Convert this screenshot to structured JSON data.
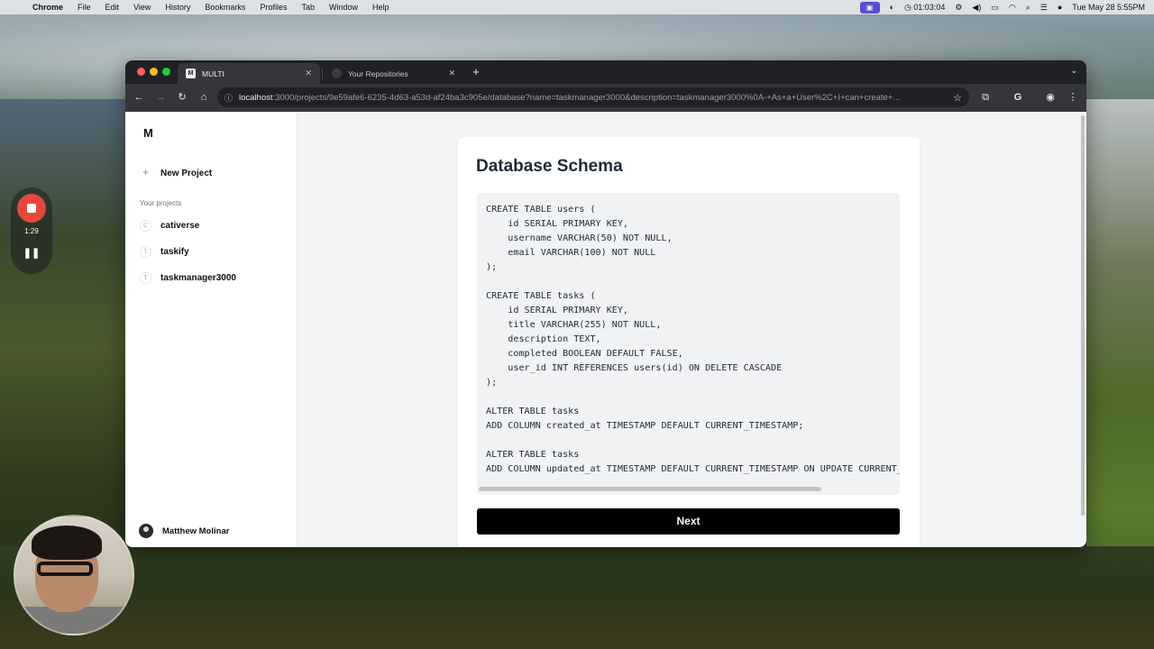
{
  "menubar": {
    "app": "Chrome",
    "items": [
      "File",
      "Edit",
      "View",
      "History",
      "Bookmarks",
      "Profiles",
      "Tab",
      "Window",
      "Help"
    ],
    "clock_timer": "01:03:04",
    "datetime": "Tue May 28  5:55PM"
  },
  "recorder": {
    "elapsed": "1:29"
  },
  "browser": {
    "tabs": [
      {
        "title": "MULTI",
        "favicon": "M",
        "active": true
      },
      {
        "title": "Your Repositories",
        "active": false
      }
    ],
    "url_host": "localhost",
    "url_rest": ":3000/projects/9e59afe6-6235-4d63-a53d-af24ba3c905e/database?name=taskmanager3000&description=taskmanager3000%0A-+As+a+User%2C+I+can+create+..."
  },
  "sidebar": {
    "logo": "M",
    "new_project": "New Project",
    "projects_label": "Your projects",
    "projects": [
      {
        "initial": "C",
        "name": "cativerse"
      },
      {
        "initial": "T",
        "name": "taskify"
      },
      {
        "initial": "T",
        "name": "taskmanager3000"
      }
    ],
    "user": "Matthew Molinar"
  },
  "main": {
    "title": "Database Schema",
    "code": "CREATE TABLE users (\n    id SERIAL PRIMARY KEY,\n    username VARCHAR(50) NOT NULL,\n    email VARCHAR(100) NOT NULL\n);\n\nCREATE TABLE tasks (\n    id SERIAL PRIMARY KEY,\n    title VARCHAR(255) NOT NULL,\n    description TEXT,\n    completed BOOLEAN DEFAULT FALSE,\n    user_id INT REFERENCES users(id) ON DELETE CASCADE\n);\n\nALTER TABLE tasks\nADD COLUMN created_at TIMESTAMP DEFAULT CURRENT_TIMESTAMP;\n\nALTER TABLE tasks\nADD COLUMN updated_at TIMESTAMP DEFAULT CURRENT_TIMESTAMP ON UPDATE CURRENT_TIMESTAMP;",
    "next_button": "Next"
  }
}
